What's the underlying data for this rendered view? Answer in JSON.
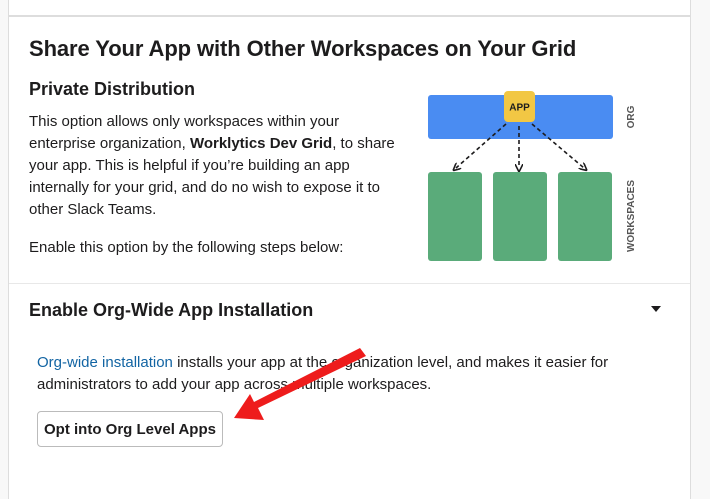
{
  "panel": {
    "title": "Share Your App with Other Workspaces on Your Grid"
  },
  "private_distribution": {
    "heading": "Private Distribution",
    "desc_part1": "This option allows only workspaces within your enterprise organization, ",
    "desc_org_name": "Worklytics Dev Grid",
    "desc_part2": ", to share your app. This is helpful if you’re building an app internally for your grid, and do no wish to expose it to other Slack Teams.",
    "enable_text": "Enable this option by the following steps below:"
  },
  "diagram": {
    "app_badge": "APP",
    "org_label": "ORG",
    "workspaces_label": "WORKSPACES",
    "colors": {
      "org_bar": "#4a8cf2",
      "app_badge": "#f2c744",
      "workspace": "#5aab7a",
      "arrows": "#1d1c1d"
    }
  },
  "org_install": {
    "heading": "Enable Org-Wide App Installation",
    "toggle_icon": "caret-down-icon",
    "link_text": "Org-wide installation",
    "desc": " installs your app at the organization level, and makes it easier for administrators to add your app across multiple workspaces.",
    "button_label": "Opt into Org Level Apps"
  },
  "annotation": {
    "arrow_color": "#ee1c1c",
    "arrow_icon": "red-pointer-arrow-icon"
  }
}
